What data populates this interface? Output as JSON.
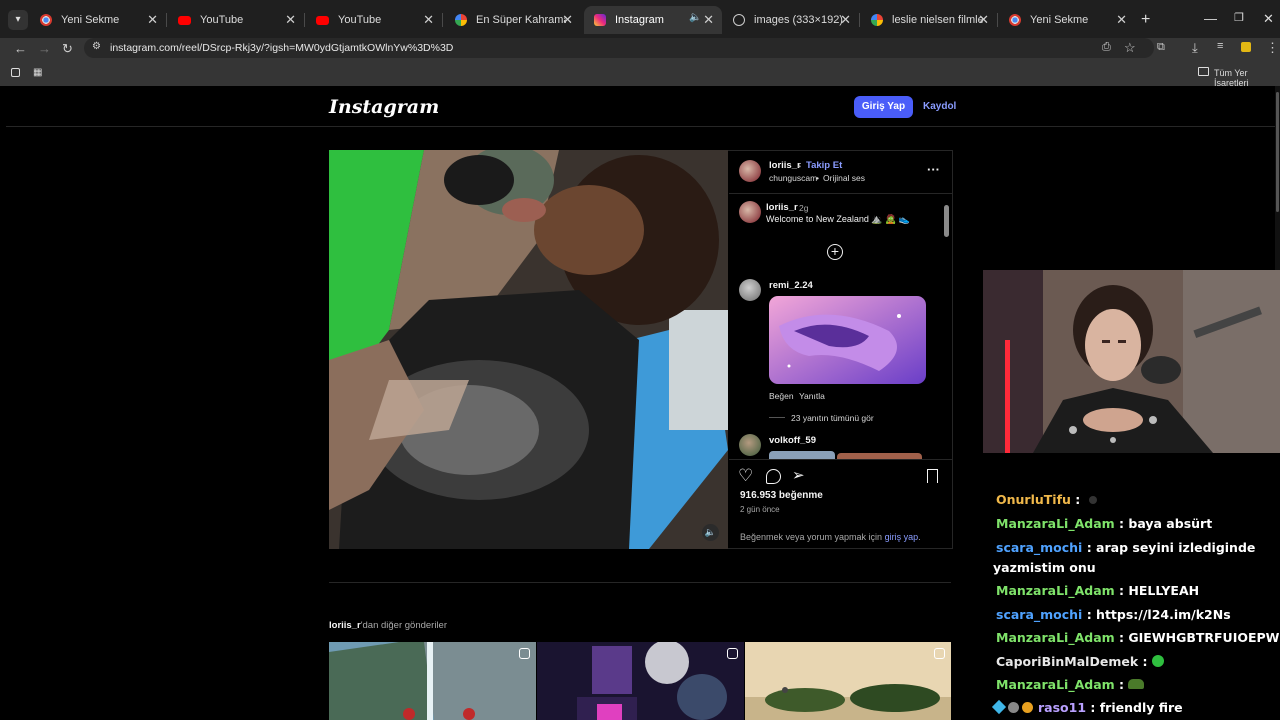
{
  "browser": {
    "tabs": [
      {
        "title": "Yeni Sekme",
        "icon": "chrome-icon",
        "active": false
      },
      {
        "title": "YouTube",
        "icon": "youtube-icon",
        "active": false
      },
      {
        "title": "YouTube",
        "icon": "youtube-icon",
        "active": false
      },
      {
        "title": "En Süper Kahraman - Goo",
        "icon": "google-icon",
        "active": false
      },
      {
        "title": "Instagram",
        "icon": "instagram-icon",
        "active": true
      },
      {
        "title": "images (333×192)",
        "icon": "globe-icon",
        "active": false
      },
      {
        "title": "leslie nielsen filmleri ve tü",
        "icon": "google-icon",
        "active": false
      },
      {
        "title": "Yeni Sekme",
        "icon": "chrome-icon",
        "active": false
      }
    ],
    "url": "instagram.com/reel/DSrcp-Rkj3y/?igsh=MW0ydGtjamtkOWlnYw%3D%3D",
    "bookmarks_all": "Tüm Yer İşaretleri"
  },
  "instagram": {
    "logo": "Instagram",
    "login_button": "Giriş Yap",
    "signup_link": "Kaydol",
    "post": {
      "author": "loriis_r",
      "follow": "Takip Et",
      "dot": "•",
      "audio_user": "chunguscam",
      "audio_label": "Orijinal ses",
      "caption_user": "loriis_r",
      "caption_age": "2g",
      "caption_text": "Welcome to New Zealand ⛰️ 🧟 👟",
      "comments": [
        {
          "user": "remi_2.24",
          "like": "Beğen",
          "reply": "Yanıtla",
          "view_replies": "23 yanıtın tümünü gör"
        },
        {
          "user": "volkoff_59"
        }
      ],
      "likes": "916.953 beğenme",
      "time": "2 gün önce",
      "login_prompt_text": "Beğenmek veya yorum yapmak için ",
      "login_prompt_link": "giriş yap",
      "login_prompt_end": "."
    },
    "more_posts": {
      "user": "loriis_r",
      "suffix": "'dan diğer gönderiler"
    }
  },
  "chat": [
    {
      "user": "OnurluTifu",
      "color": "#f0b84a",
      "message": ""
    },
    {
      "user": "ManzaraLi_Adam",
      "color": "#7fe36a",
      "message": "baya absürt"
    },
    {
      "user": "scara_mochi",
      "color": "#4fa2ff",
      "message": "arap seyini izlediginde",
      "cont": "yazmistim onu"
    },
    {
      "user": "ManzaraLi_Adam",
      "color": "#7fe36a",
      "message": "HELLYEAH"
    },
    {
      "user": "scara_mochi",
      "color": "#4fa2ff",
      "message": "https://l24.im/k2Ns"
    },
    {
      "user": "ManzaraLi_Adam",
      "color": "#7fe36a",
      "message": "GIEWHGBTRFUIOEPW"
    },
    {
      "user": "CaporiBinMalDemek",
      "color": "#e8e8e8",
      "message": ""
    },
    {
      "user": "ManzaraLi_Adam",
      "color": "#7fe36a",
      "message": ""
    },
    {
      "user": "raso11",
      "color": "#b9a0ff",
      "message": "friendly fire"
    }
  ]
}
